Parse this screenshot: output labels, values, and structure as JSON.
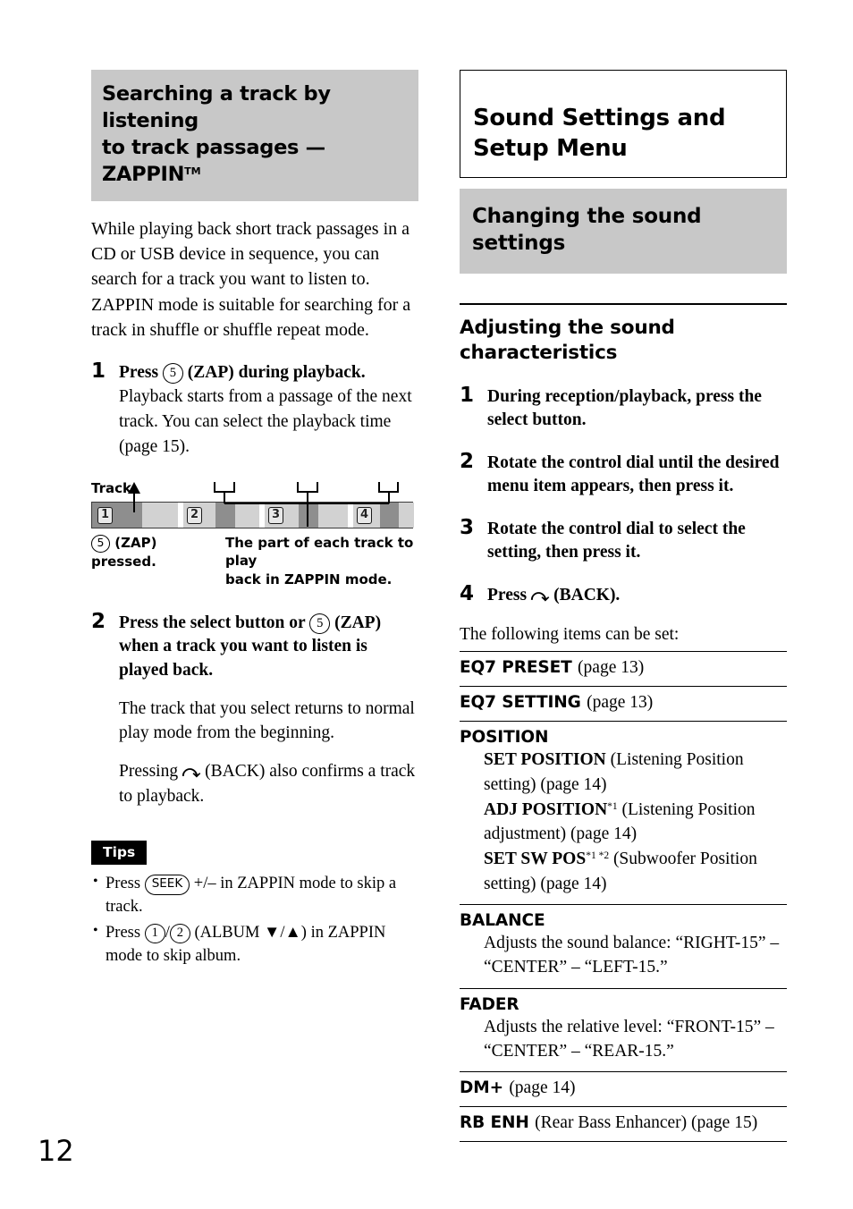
{
  "page": {
    "number": "12"
  },
  "left": {
    "heading": {
      "line1": "Searching a track by listening",
      "line2_pre": "to track passages — ZAPPIN",
      "trademark": "TM"
    },
    "intro": "While playing back short track passages in a CD or USB device in sequence, you can search for a track you want to listen to. ZAPPIN mode is suitable for searching for a track in shuffle or shuffle repeat mode.",
    "step1": {
      "num": "1",
      "lead_pre": "Press",
      "button": "5",
      "lead_post": "(ZAP) during playback.",
      "body": "Playback starts from a passage of the next track. You can select the playback time (page 15)."
    },
    "diagram": {
      "label": "Track",
      "tracks": [
        "1",
        "2",
        "3",
        "4"
      ],
      "caption_left_button": "5",
      "caption_left_text": "(ZAP) pressed.",
      "caption_right_line1": "The part of each track to play",
      "caption_right_line2": "back in ZAPPIN mode."
    },
    "step2": {
      "num": "2",
      "lead_pre": "Press the select button or",
      "button": "5",
      "lead_post": "(ZAP) when a track you want to listen is played back.",
      "body1": "The track that you select returns to normal play mode from the beginning.",
      "body2_pre": "Pressing",
      "body2_glyph": "back-icon",
      "body2_post": "(BACK) also confirms a track to playback."
    },
    "tips": {
      "label": "Tips",
      "items": [
        {
          "pre": "Press",
          "button": "SEEK",
          "post": "+/– in ZAPPIN mode to skip a track."
        },
        {
          "pre": "Press",
          "button1": "1",
          "sep": "/",
          "button2": "2",
          "post": "(ALBUM ▼/▲) in ZAPPIN mode to skip album."
        }
      ]
    }
  },
  "right": {
    "chapter": {
      "line1": "Sound Settings and",
      "line2": "Setup Menu"
    },
    "band": {
      "line1": "Changing the sound",
      "line2": "settings"
    },
    "section": {
      "line1": "Adjusting the sound",
      "line2": "characteristics"
    },
    "steps": [
      {
        "num": "1",
        "text": "During reception/playback, press the select button."
      },
      {
        "num": "2",
        "text": "Rotate the control dial until the desired menu item appears, then press it."
      },
      {
        "num": "3",
        "text": "Rotate the control dial to select the setting, then press it."
      }
    ],
    "step4": {
      "num": "4",
      "pre": "Press",
      "glyph": "back-icon",
      "post": "(BACK)."
    },
    "intro": "The following items can be set:",
    "settings": [
      {
        "title": "EQ7 PRESET",
        "page": "(page 13)",
        "subs": []
      },
      {
        "title": "EQ7 SETTING",
        "page": "(page 13)",
        "subs": []
      },
      {
        "title": "POSITION",
        "page": "",
        "subs": [
          {
            "name": "SET POSITION",
            "note": "",
            "desc": "(Listening Position setting) (page 14)"
          },
          {
            "name": "ADJ POSITION",
            "note": "*1",
            "desc": "(Listening Position adjustment) (page 14)"
          },
          {
            "name": "SET SW POS",
            "note": "*1 *2",
            "desc": "(Subwoofer Position setting) (page 14)"
          }
        ]
      },
      {
        "title": "BALANCE",
        "page": "",
        "subs": [
          {
            "name": "",
            "note": "",
            "desc": "Adjusts the sound balance: “RIGHT-15” – “CENTER” – “LEFT-15.”"
          }
        ]
      },
      {
        "title": "FADER",
        "page": "",
        "subs": [
          {
            "name": "",
            "note": "",
            "desc": "Adjusts the relative level: “FRONT-15” – “CENTER” – “REAR-15.”"
          }
        ]
      },
      {
        "title": "DM+",
        "page": "(page 14)",
        "subs": []
      },
      {
        "title": "RB ENH",
        "page": "(Rear Bass Enhancer) (page 15)",
        "subs": []
      }
    ]
  }
}
